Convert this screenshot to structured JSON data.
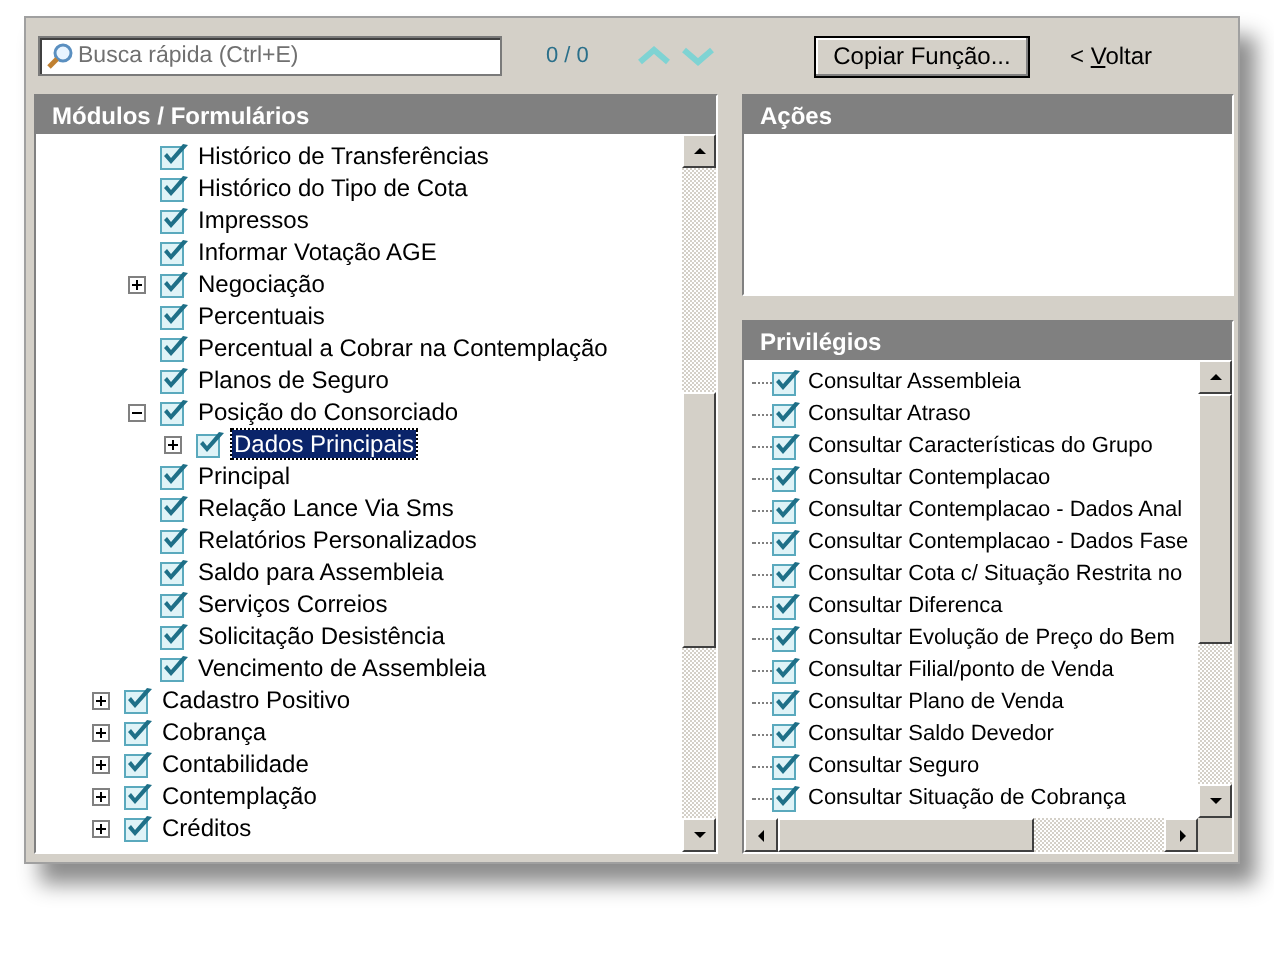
{
  "search": {
    "placeholder": "Busca rápida (Ctrl+E)",
    "count": "0 / 0"
  },
  "modules": {
    "title": "Módulos / Formulários",
    "continued_children": [
      {
        "label": "Histórico de Transferências",
        "checked": true,
        "selected": false
      },
      {
        "label": "Histórico do Tipo de Cota",
        "checked": true,
        "selected": false
      },
      {
        "label": "Impressos",
        "checked": true,
        "selected": false
      },
      {
        "label": "Informar Votação AGE",
        "checked": true,
        "selected": false
      },
      {
        "label": "Negociação",
        "checked": true,
        "selected": false,
        "expanded": false
      },
      {
        "label": "Percentuais",
        "checked": true,
        "selected": false
      },
      {
        "label": "Percentual a Cobrar na Contemplação",
        "checked": true,
        "selected": false
      },
      {
        "label": "Planos de Seguro",
        "checked": true,
        "selected": false
      },
      {
        "label": "Posição do Consorciado",
        "checked": true,
        "selected": false,
        "expanded": true,
        "children": [
          {
            "label": "Dados Principais",
            "checked": true,
            "selected": true,
            "expanded": false
          }
        ]
      },
      {
        "label": "Principal",
        "checked": true,
        "selected": false
      },
      {
        "label": "Relação Lance Via Sms",
        "checked": true,
        "selected": false
      },
      {
        "label": "Relatórios Personalizados",
        "checked": true,
        "selected": false
      },
      {
        "label": "Saldo para Assembleia",
        "checked": true,
        "selected": false
      },
      {
        "label": "Serviços Correios",
        "checked": true,
        "selected": false
      },
      {
        "label": "Solicitação Desistência",
        "checked": true,
        "selected": false
      },
      {
        "label": "Vencimento de Assembleia",
        "checked": true,
        "selected": false
      }
    ],
    "items": [
      {
        "label": "Cadastro Positivo",
        "checked": true,
        "selected": false,
        "expanded": false
      },
      {
        "label": "Cobrança",
        "checked": true,
        "selected": false,
        "expanded": false
      },
      {
        "label": "Contabilidade",
        "checked": true,
        "selected": false,
        "expanded": false
      },
      {
        "label": "Contemplação",
        "checked": true,
        "selected": false,
        "expanded": false
      },
      {
        "label": "Créditos",
        "checked": true,
        "selected": false,
        "expanded": false
      }
    ]
  },
  "copy_button": "Copiar Função...",
  "back_link": {
    "label": "< Voltar"
  },
  "actions": {
    "title": "Ações"
  },
  "privileges": {
    "title": "Privilégios",
    "items": [
      {
        "label": "Consultar Assembleia",
        "checked": true
      },
      {
        "label": "Consultar Atraso",
        "checked": true
      },
      {
        "label": "Consultar Características do Grupo",
        "checked": true
      },
      {
        "label": "Consultar Contemplacao",
        "checked": true
      },
      {
        "label": "Consultar Contemplacao - Dados Anal",
        "checked": true
      },
      {
        "label": "Consultar Contemplacao - Dados Fase",
        "checked": true
      },
      {
        "label": "Consultar Cota c/ Situação Restrita no",
        "checked": true
      },
      {
        "label": "Consultar Diferenca",
        "checked": true
      },
      {
        "label": "Consultar Evolução de Preço do Bem",
        "checked": true
      },
      {
        "label": "Consultar Filial/ponto de Venda",
        "checked": true
      },
      {
        "label": "Consultar Plano de Venda",
        "checked": true
      },
      {
        "label": "Consultar Saldo Devedor",
        "checked": true
      },
      {
        "label": "Consultar Seguro",
        "checked": true
      },
      {
        "label": "Consultar Situação de Cobrança",
        "checked": true
      }
    ]
  }
}
